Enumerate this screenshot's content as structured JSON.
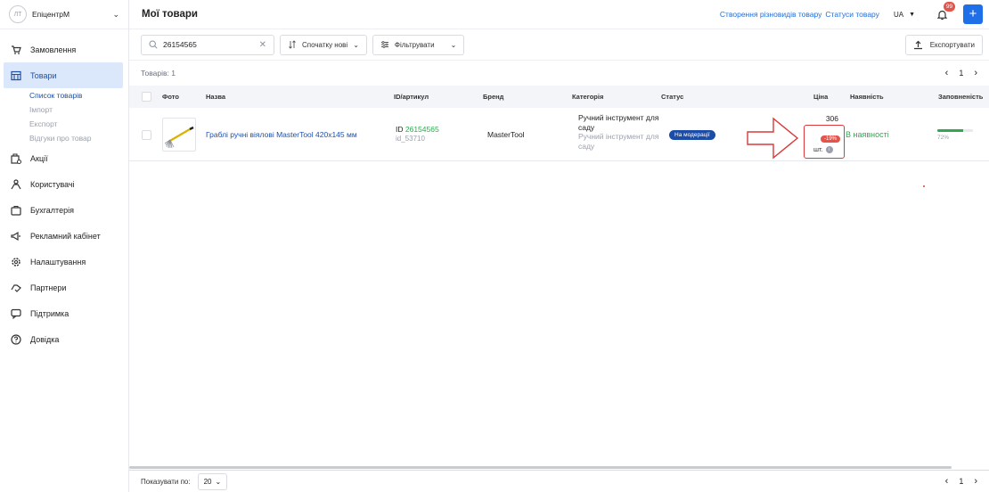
{
  "sidebar": {
    "avatar_initials": "ЛТ",
    "company": "ЕпіцентрМ",
    "items": [
      {
        "label": "Замовлення",
        "icon": "cart-icon"
      },
      {
        "label": "Товари",
        "icon": "products-icon"
      },
      {
        "label": "Акції",
        "icon": "promo-icon"
      },
      {
        "label": "Користувачі",
        "icon": "users-icon"
      },
      {
        "label": "Бухгалтерія",
        "icon": "accounting-icon"
      },
      {
        "label": "Рекламний кабінет",
        "icon": "megaphone-icon"
      },
      {
        "label": "Налаштування",
        "icon": "gear-icon"
      },
      {
        "label": "Партнери",
        "icon": "handshake-icon"
      },
      {
        "label": "Підтримка",
        "icon": "chat-icon"
      },
      {
        "label": "Довідка",
        "icon": "help-icon"
      }
    ],
    "subitems": [
      "Список товарів",
      "Імпорт",
      "Експорт",
      "Відгуки про товар"
    ]
  },
  "header": {
    "title": "Мої товари",
    "link1": "Створення різновидів товару",
    "link2": "Статуси товару",
    "lang": "UA",
    "notifications": "99",
    "plus": "+"
  },
  "toolbar": {
    "search_value": "26154565",
    "sort_label": "Спочатку нові",
    "filter_label": "Фільтрувати",
    "export_label": "Експортувати"
  },
  "listing": {
    "count": "Товарів: 1",
    "page": "1"
  },
  "table": {
    "columns": [
      "Фото",
      "Назва",
      "ID/артикул",
      "Бренд",
      "Категорія",
      "Статус",
      "Ціна",
      "Наявність",
      "Заповненість"
    ],
    "row": {
      "name": "Граблі ручні віялові MasterTool 420х145 мм",
      "id_prefix": "ID ",
      "id": "26154565",
      "sku": "id_53710",
      "brand": "MasterTool",
      "category": "Ручний інструмент для саду",
      "category_sub": "Ручний інструмент для саду",
      "status": "На модерації",
      "price": "306",
      "discount": "-19%",
      "unit": "шт.",
      "availability": "В наявності",
      "completeness_text": "72%",
      "completeness": 0.72
    }
  },
  "footer": {
    "per_page_label": "Показувати по:",
    "per_page_value": "20",
    "page": "1"
  },
  "colors": {
    "accent": "#1f6fe8",
    "status_badge": "#1b4da8",
    "available": "#2fa84f",
    "discount": "#e5534b",
    "highlight": "#d93a3a"
  }
}
